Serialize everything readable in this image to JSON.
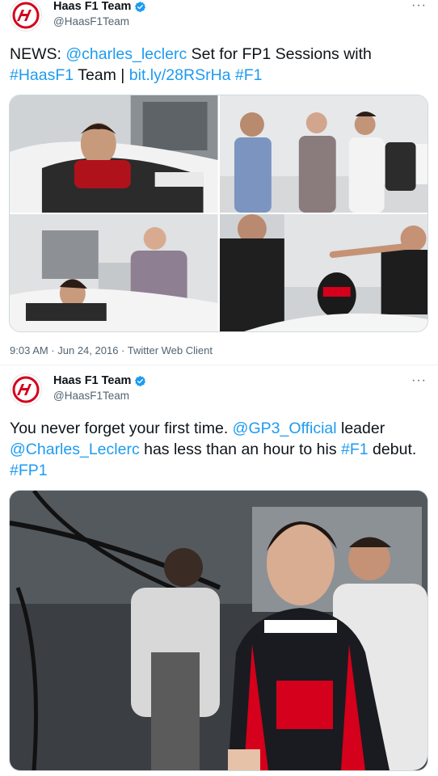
{
  "tweet1": {
    "author_name": "Haas F1 Team",
    "author_handle": "@HaasF1Team",
    "more": "···",
    "text": {
      "p1": "NEWS: ",
      "l1": "@charles_leclerc",
      "p2": " Set for FP1 Sessions with ",
      "l2": "#HaasF1",
      "p3": " Team | ",
      "l3": "bit.ly/28RSrHa",
      "p4": " ",
      "l4": "#F1"
    },
    "timestamp": "9:03 AM · Jun 24, 2016 · Twitter Web Client"
  },
  "tweet2": {
    "author_name": "Haas F1 Team",
    "author_handle": "@HaasF1Team",
    "more": "···",
    "text": {
      "p1": "You never forget your first time. ",
      "l1": "@GP3_Official",
      "p2": " leader ",
      "l2": "@Charles_Leclerc",
      "p3": " has less than an hour to his ",
      "l3": "#F1",
      "p4": " debut. ",
      "l4": "#FP1"
    }
  },
  "colors": {
    "link": "#1d9bf0",
    "verified": "#1d9bf0",
    "brand_red": "#d5001c",
    "muted": "#536471"
  },
  "icons": {
    "avatar": "haas-logo-icon",
    "verified": "verified-badge-icon",
    "more": "more-icon"
  }
}
